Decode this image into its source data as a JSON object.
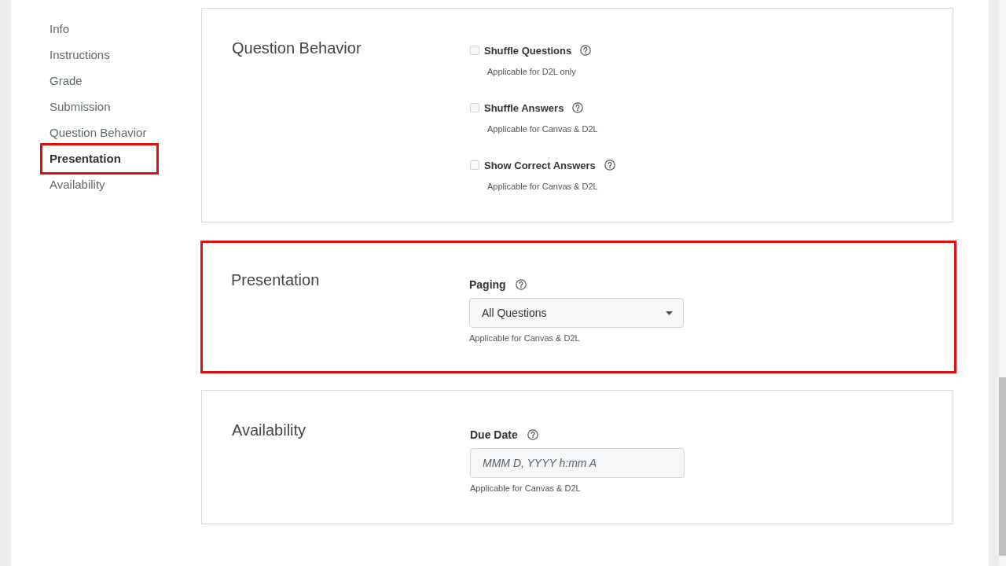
{
  "sidebar": {
    "items": [
      {
        "label": "Info",
        "selected": false,
        "highlighted": false
      },
      {
        "label": "Instructions",
        "selected": false,
        "highlighted": false
      },
      {
        "label": "Grade",
        "selected": false,
        "highlighted": false
      },
      {
        "label": "Submission",
        "selected": false,
        "highlighted": false
      },
      {
        "label": "Question Behavior",
        "selected": false,
        "highlighted": false
      },
      {
        "label": "Presentation",
        "selected": true,
        "highlighted": true
      },
      {
        "label": "Availability",
        "selected": false,
        "highlighted": false
      }
    ]
  },
  "sections": [
    {
      "title": "Question Behavior",
      "highlighted": false,
      "fields": [
        {
          "kind": "checkbox",
          "label": "Shuffle Questions",
          "checked": false,
          "hint": "Applicable for D2L only"
        },
        {
          "kind": "checkbox",
          "label": "Shuffle Answers",
          "checked": false,
          "hint": "Applicable for Canvas & D2L"
        },
        {
          "kind": "checkbox",
          "label": "Show Correct Answers",
          "checked": false,
          "hint": "Applicable for Canvas & D2L"
        }
      ]
    },
    {
      "title": "Presentation",
      "highlighted": true,
      "fields": [
        {
          "kind": "select",
          "label": "Paging",
          "value": "All Questions",
          "hint": "Applicable for Canvas & D2L"
        }
      ]
    },
    {
      "title": "Availability",
      "highlighted": false,
      "fields": [
        {
          "kind": "datetime",
          "label": "Due Date",
          "placeholder": "MMM D, YYYY h:mm A",
          "hint": "Applicable for Canvas & D2L"
        }
      ]
    }
  ]
}
